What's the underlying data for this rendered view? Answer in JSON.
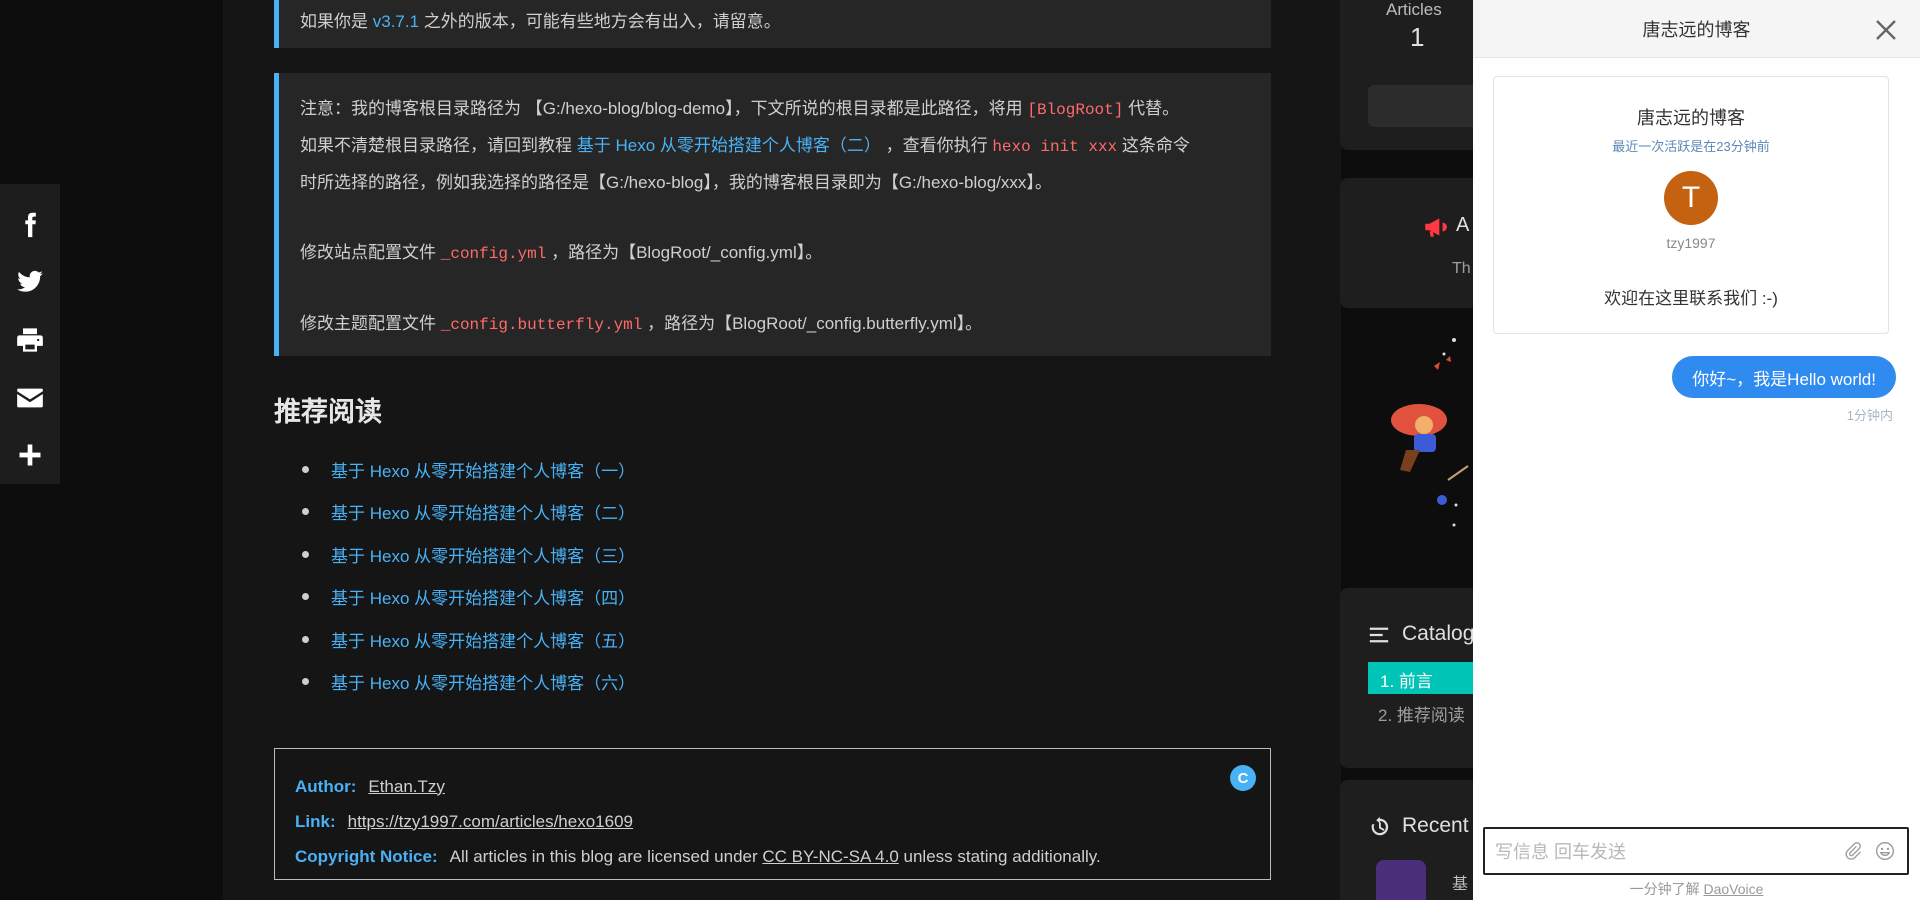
{
  "article": {
    "quote1": {
      "prefix": "如果你是 ",
      "version_link": "v3.7.1",
      "suffix": " 之外的版本，可能有些地方会有出入，请留意。"
    },
    "quote2": {
      "line1_a": "注意：我的博客根目录路径为 【G:/hexo-blog/blog-demo】，下文所说的根目录都是此路径，将用 ",
      "line1_code": "[BlogRoot]",
      "line1_b": " 代替。",
      "line2_a": "如果不清楚根目录路径，请回到教程 ",
      "line2_link": "基于 Hexo 从零开始搭建个人博客（二）",
      "line2_b": " ，查看你执行 ",
      "line2_code": "hexo init xxx",
      "line2_c": " 这条命令",
      "line3": "时所选择的路径，例如我选择的路径是【G:/hexo-blog】，我的博客根目录即为【G:/hexo-blog/xxx】。",
      "site_a": "修改站点配置文件 ",
      "site_code": "_config.yml",
      "site_b": " ，路径为【BlogRoot/_config.yml】。",
      "theme_a": "修改主题配置文件 ",
      "theme_code": "_config.butterfly.yml",
      "theme_b": " ，路径为【BlogRoot/_config.butterfly.yml】。"
    },
    "recommended": {
      "title": "推荐阅读",
      "items": [
        "基于 Hexo 从零开始搭建个人博客（一）",
        "基于 Hexo 从零开始搭建个人博客（二）",
        "基于 Hexo 从零开始搭建个人博客（三）",
        "基于 Hexo 从零开始搭建个人博客（四）",
        "基于 Hexo 从零开始搭建个人博客（五）",
        "基于 Hexo 从零开始搭建个人博客（六）"
      ]
    },
    "copyright": {
      "author_label": "Author:",
      "author_value": "Ethan.Tzy",
      "link_label": "Link:",
      "link_value": "https://tzy1997.com/articles/hexo1609",
      "notice_label": "Copyright Notice:",
      "notice_a": "All articles in this blog are licensed under ",
      "notice_license": "CC BY-NC-SA 4.0",
      "notice_b": " unless stating additionally.",
      "cc_icon": "C"
    }
  },
  "share_rail": {
    "items": [
      "facebook-icon",
      "twitter-icon",
      "print-icon",
      "email-icon",
      "plus-icon"
    ]
  },
  "sidebar": {
    "articles_label": "Articles",
    "articles_count": "1",
    "announcement_label": "A",
    "announcement_text": "Th",
    "toc_title": "Catalog",
    "toc_items": [
      "1. 前言",
      "2. 推荐阅读"
    ],
    "recent_title": "Recent",
    "recent_item": "基"
  },
  "chat": {
    "header_title": "唐志远的博客",
    "card": {
      "name": "唐志远的博客",
      "active": "最近一次活跃是在23分钟前",
      "avatar_letter": "T",
      "username": "tzy1997",
      "welcome": "欢迎在这里联系我们 :-)"
    },
    "message": "你好~，我是Hello world!",
    "message_time": "1分钟内",
    "input_placeholder": "写信息 回车发送",
    "footer_text": "一分钟了解 ",
    "footer_link": "DaoVoice"
  },
  "colors": {
    "accent": "#49b1f5",
    "code": "#ff6a6a",
    "toc_active": "#00c4b6",
    "chat_bubble": "#2f8bf0",
    "avatar": "#c46212"
  }
}
